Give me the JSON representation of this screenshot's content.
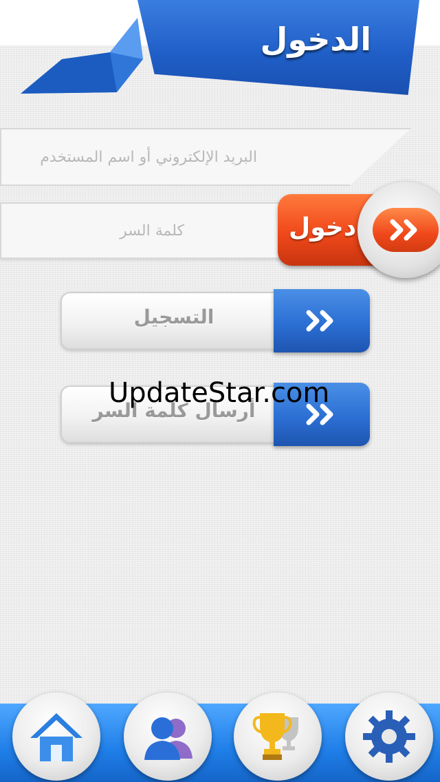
{
  "header": {
    "title": "الدخول"
  },
  "form": {
    "email_placeholder": "البريد الإلكتروني أو اسم المستخدم",
    "password_placeholder": "كلمة السر",
    "login_label": "دخول"
  },
  "buttons": {
    "register_label": "التسجيل",
    "send_password_label": "أرسال كلمة السر"
  },
  "watermark": "UpdateStar.com",
  "nav": [
    {
      "icon": "home-icon"
    },
    {
      "icon": "users-icon"
    },
    {
      "icon": "trophy-icon"
    },
    {
      "icon": "gear-icon"
    }
  ],
  "colors": {
    "header_blue": "#2a6fd8",
    "login_orange": "#f0481a",
    "arrow_blue": "#2c6fd4",
    "nav_blue": "#1f7ee8"
  }
}
